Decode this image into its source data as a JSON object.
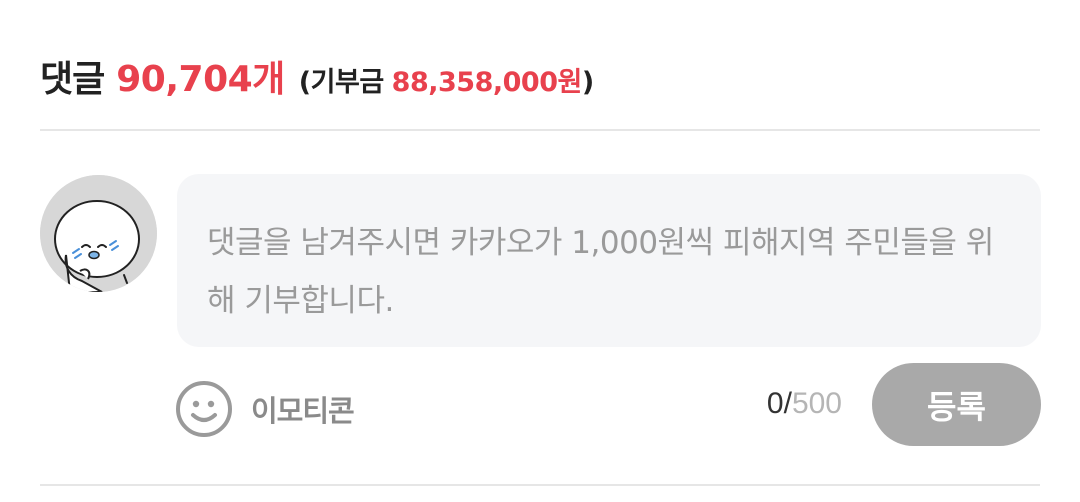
{
  "header": {
    "label": "댓글",
    "count": "90,704개",
    "donation_label": "기부금",
    "donation_amount": "88,358,000원",
    "paren_open": "(",
    "paren_close": ")"
  },
  "comment_input": {
    "placeholder": "댓글을 남겨주시면 카카오가 1,000원씩 피해지역 주민들을 위해 기부합니다.",
    "value": ""
  },
  "toolbar": {
    "emoticon_label": "이모티콘",
    "char_count": "0",
    "char_sep": "/",
    "char_max": "500",
    "submit_label": "등록"
  },
  "colors": {
    "accent": "#e8414d",
    "button_disabled": "#a9a9a9",
    "input_bg": "#f5f6f8",
    "divider": "#e6e6e6"
  },
  "icons": {
    "avatar": "cartoon-face-avatar",
    "emoticon": "smile-icon"
  }
}
